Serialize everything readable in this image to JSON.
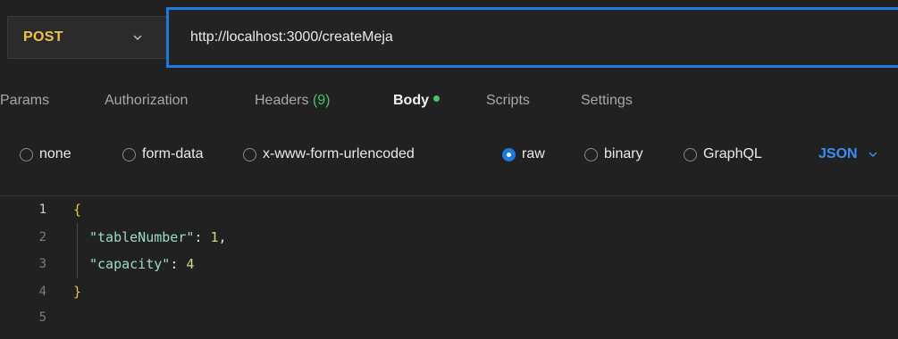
{
  "request": {
    "method": "POST",
    "url": "http://localhost:3000/createMeja"
  },
  "tabs": [
    {
      "label": "Params"
    },
    {
      "label": "Authorization"
    },
    {
      "label": "Headers",
      "count": "(9)"
    },
    {
      "label": "Body"
    },
    {
      "label": "Scripts"
    },
    {
      "label": "Settings"
    }
  ],
  "body_types": {
    "options": [
      "none",
      "form-data",
      "x-www-form-urlencoded",
      "raw",
      "binary",
      "GraphQL"
    ],
    "selected": "raw",
    "format": "JSON"
  },
  "editor": {
    "line_numbers": [
      "1",
      "2",
      "3",
      "4",
      "5"
    ],
    "lines": {
      "l1": "{",
      "l2_key": "\"tableNumber\"",
      "l2_sep": ": ",
      "l2_val": "1",
      "l2_comma": ",",
      "l3_key": "\"capacity\"",
      "l3_sep": ": ",
      "l3_val": "4",
      "l4": "}"
    }
  },
  "colors": {
    "method": "#f0c24a",
    "url_focus_border": "#1f7ae0",
    "active_dot": "#49c26a",
    "json_accent": "#3b8ef0"
  }
}
